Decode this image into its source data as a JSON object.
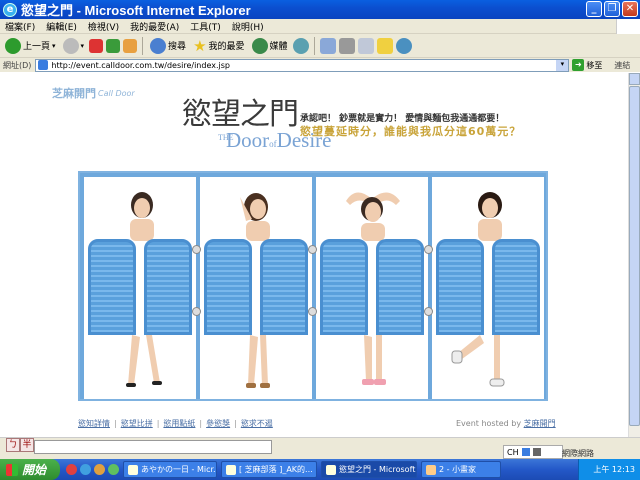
{
  "window": {
    "title": "慾望之門 - Microsoft Internet Explorer"
  },
  "menu": [
    "檔案(F)",
    "編輯(E)",
    "檢視(V)",
    "我的最愛(A)",
    "工具(T)",
    "說明(H)"
  ],
  "toolbar": {
    "back": "上一頁",
    "search": "搜尋",
    "favorites": "我的最愛",
    "media": "媒體"
  },
  "address": {
    "label": "網址(D)",
    "url": "http://event.calldoor.com.tw/desire/index.jsp",
    "go": "移至",
    "links": "連結"
  },
  "page": {
    "brand_zh": "芝麻開門",
    "brand_en": "Call Door",
    "title_zh": "慾望之門",
    "title_the": "THE",
    "title_en_1": "Door",
    "title_en_of": "of",
    "title_en_2": "Desire",
    "tagline1": "承認吧！ 鈔票就是實力！ 愛情與麵包我通通都要！",
    "tagline2": "慾望蔓延時分，誰能與我瓜分這60萬元？",
    "footer_links": [
      "慾知詳情",
      "慾望比拼",
      "慾用點紙",
      "參慾獎",
      "慾求不遏"
    ],
    "hosted_label": "Event hosted by",
    "hosted_link": "芝麻開門"
  },
  "ime": {
    "a": "ㄅ",
    "b": "半"
  },
  "langbar": {
    "lang": "CH"
  },
  "zone": "網際網路",
  "taskbar": {
    "start": "開始",
    "tasks": [
      "あやかの一日 - Micr...",
      "[ 芝麻部落 ]_AK的...",
      "慾望之門 - Microsoft ...",
      "2 - 小畫家"
    ],
    "clock": "上午 12:13"
  }
}
